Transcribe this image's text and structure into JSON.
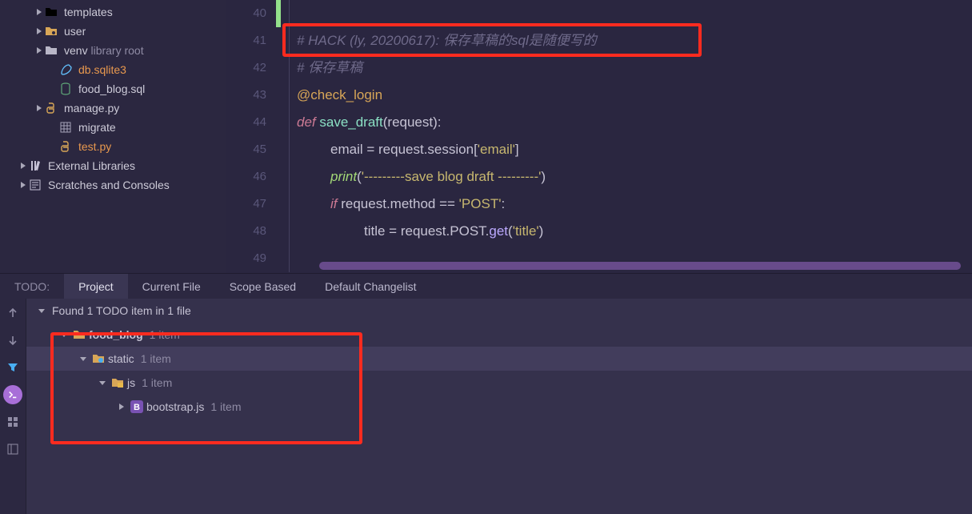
{
  "tree": {
    "templates": "templates",
    "user": "user",
    "venv": "venv",
    "venv_hint": "library root",
    "db": "db.sqlite3",
    "sql": "food_blog.sql",
    "manage": "manage.py",
    "migrate": "migrate",
    "test": "test.py",
    "extlib": "External Libraries",
    "scratch": "Scratches and Consoles"
  },
  "code": {
    "l40": "",
    "l41_a": "# HACK (ly, 20200617): ",
    "l41_b": "保存草稿的sql是随便写的",
    "l42": "# 保存草稿",
    "l43": "@check_login",
    "l44_def": "def ",
    "l44_fn": "save_draft",
    "l44_p": "(request):",
    "l45_a": "email = request",
    "l45_b": ".session[",
    "l45_c": "'email'",
    "l45_d": "]",
    "l46_a": "print",
    "l46_b": "(",
    "l46_c": "'---------save blog draft ---------'",
    "l46_d": ")",
    "l47_a": "if ",
    "l47_b": "request",
    "l47_c": ".method == ",
    "l47_d": "'POST'",
    "l47_e": ":",
    "l48_a": "title = request",
    "l48_b": ".POST.",
    "l48_c": "get",
    "l48_d": "(",
    "l48_e": "'title'",
    "l48_f": ")"
  },
  "lines": {
    "40": "40",
    "41": "41",
    "42": "42",
    "43": "43",
    "44": "44",
    "45": "45",
    "46": "46",
    "47": "47",
    "48": "48",
    "49": "49"
  },
  "tabs": {
    "todo_label": "TODO:",
    "project": "Project",
    "current": "Current File",
    "scope": "Scope Based",
    "changelist": "Default Changelist"
  },
  "results": {
    "summary": "Found 1 TODO item in 1 file",
    "food_blog": "food_blog",
    "food_blog_cnt": "1 item",
    "static": "static",
    "static_cnt": "1 item",
    "js": "js",
    "js_cnt": "1 item",
    "bootstrap": "bootstrap.js",
    "bootstrap_cnt": "1 item"
  }
}
